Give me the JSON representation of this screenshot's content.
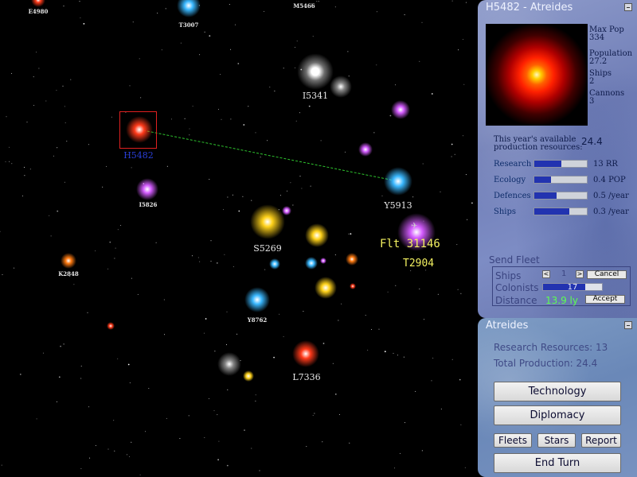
{
  "planet_panel": {
    "title": "H5482 - Atreides",
    "stats": [
      {
        "label": "Max Pop",
        "value": "334"
      },
      {
        "label": "Population",
        "value": "27.2"
      },
      {
        "label": "Ships",
        "value": "2"
      },
      {
        "label": "Cannons",
        "value": "3"
      }
    ],
    "production_label": "This year's available production resources:",
    "production_value": "24.4",
    "allocations": [
      {
        "label": "Research",
        "value": "13 RR",
        "level": 0.52
      },
      {
        "label": "Ecology",
        "value": "0.4 POP",
        "level": 0.32
      },
      {
        "label": "Defences",
        "value": "0.5 /year",
        "level": 0.42
      },
      {
        "label": "Ships",
        "value": "0.3 /year",
        "level": 0.66
      }
    ],
    "send_fleet": {
      "title": "Send Fleet",
      "ships_label": "Ships",
      "ships_count": "1",
      "decrement": "<",
      "increment": ">",
      "cancel_label": "Cancel",
      "colonists_label": "Colonists",
      "colonists_value": "17",
      "distance_label": "Distance",
      "distance_value": "13.9 ly",
      "accept_label": "Accept"
    }
  },
  "empire_panel": {
    "title": "Atreides",
    "research_resources": "Research Resources: 13",
    "total_production": "Total Production: 24.4",
    "buttons": {
      "technology": "Technology",
      "diplomacy": "Diplomacy",
      "fleets": "Fleets",
      "stars": "Stars",
      "report": "Report",
      "end_turn": "End Turn"
    }
  },
  "map": {
    "selected_star": "H5482",
    "fleet": {
      "label": "Flt 31146",
      "destination": "T2904"
    },
    "star_labels": {
      "e4980": "E4980",
      "t3007": "T3007",
      "m5466": "M5466",
      "i5341": "I5341",
      "h5482": "H5482",
      "i5826": "I5826",
      "y5913": "Y5913",
      "s5269": "S5269",
      "k2848": "K2848",
      "y8762": "Y8762",
      "l7336": "L7336"
    },
    "colors": {
      "red": "#ff3a1a",
      "yellow": "#ffd21a",
      "blue": "#3ab8ff",
      "white": "#ffffff",
      "magenta": "#d45cff",
      "orange": "#ff7a10"
    }
  }
}
